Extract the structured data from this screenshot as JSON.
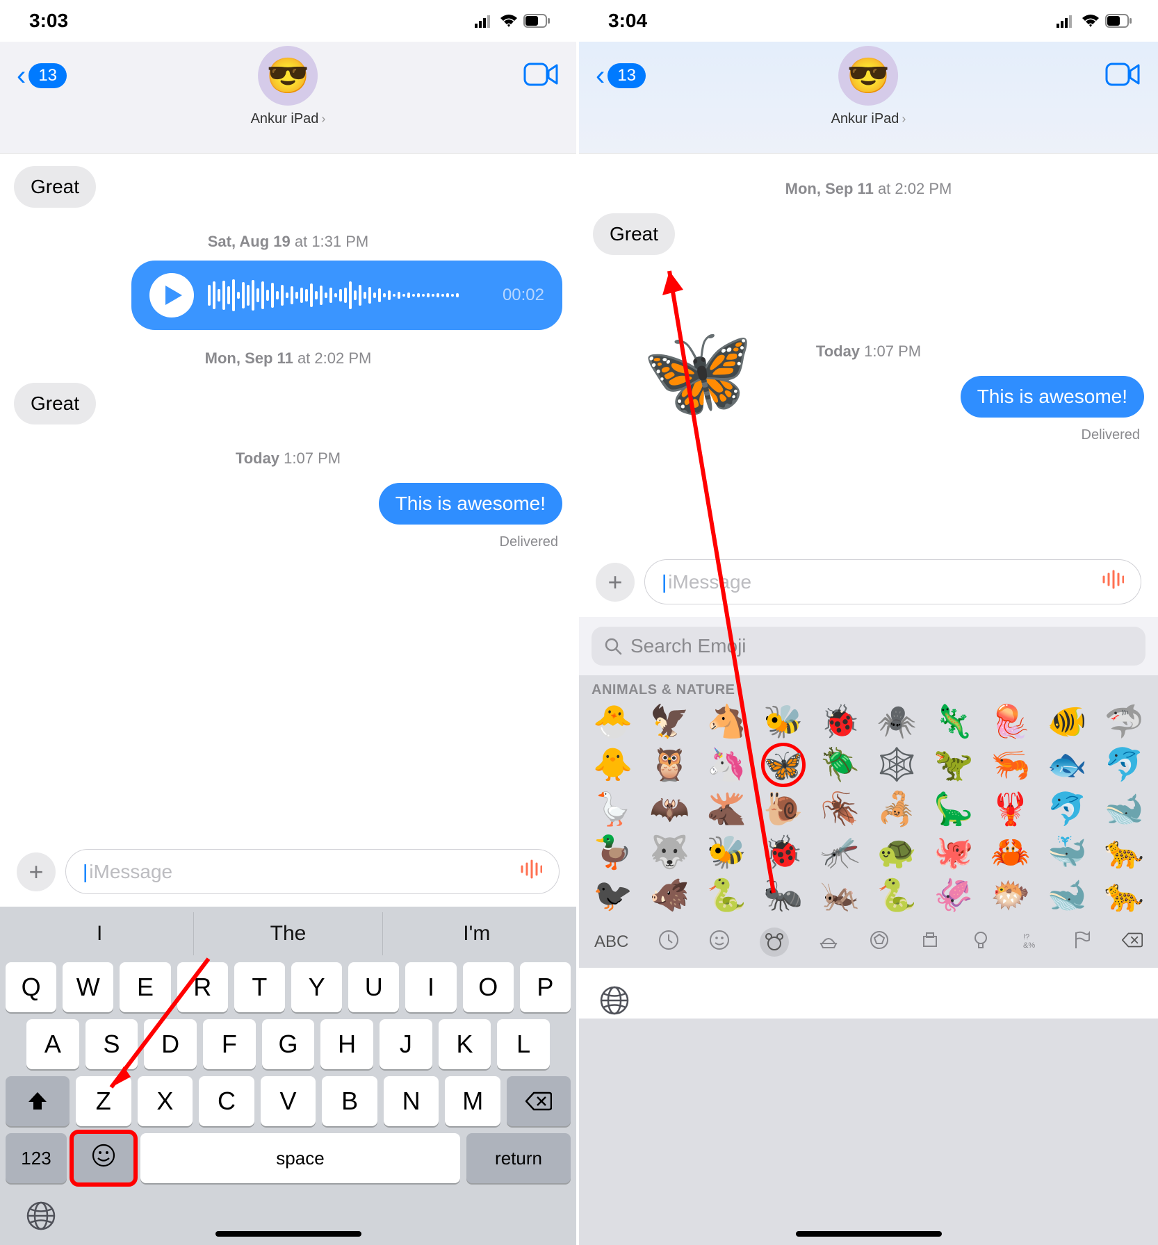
{
  "left": {
    "status": {
      "time": "3:03"
    },
    "header": {
      "back_badge": "13",
      "contact": "Ankur iPad",
      "avatar_emoji": "😎"
    },
    "msgs": {
      "gray1": "Great",
      "ts1_day": "Sat, Aug 19",
      "ts1_time": "at 1:31 PM",
      "audio_time": "00:02",
      "ts2_day": "Mon, Sep 11",
      "ts2_time": "at 2:02 PM",
      "gray2": "Great",
      "ts3_day": "Today",
      "ts3_time": "1:07 PM",
      "blue1": "This is awesome!",
      "delivered": "Delivered"
    },
    "input": {
      "placeholder": "iMessage"
    },
    "kbd": {
      "suggestions": [
        "I",
        "The",
        "I'm"
      ],
      "row1": [
        "Q",
        "W",
        "E",
        "R",
        "T",
        "Y",
        "U",
        "I",
        "O",
        "P"
      ],
      "row2": [
        "A",
        "S",
        "D",
        "F",
        "G",
        "H",
        "J",
        "K",
        "L"
      ],
      "row3": [
        "Z",
        "X",
        "C",
        "V",
        "B",
        "N",
        "M"
      ],
      "k123": "123",
      "space": "space",
      "return": "return"
    }
  },
  "right": {
    "status": {
      "time": "3:04"
    },
    "header": {
      "back_badge": "13",
      "contact": "Ankur iPad",
      "avatar_emoji": "😎"
    },
    "msgs": {
      "ts1_day": "Mon, Sep 11",
      "ts1_time": "at 2:02 PM",
      "gray1": "Great",
      "ts2_day": "Today",
      "ts2_time": "1:07 PM",
      "blue1": "This is awesome!",
      "delivered": "Delivered"
    },
    "input": {
      "placeholder": "iMessage"
    },
    "picker": {
      "search_placeholder": "Search Emoji",
      "category": "ANIMALS & NATURE",
      "rows": [
        [
          "🐣",
          "🦅",
          "🐴",
          "🐝",
          "🐞",
          "🕷️",
          "🦎",
          "🪼",
          "🐠",
          "🦈"
        ],
        [
          "🐥",
          "🦉",
          "🦄",
          "🦋",
          "🪲",
          "🕸️",
          "🦖",
          "🦐",
          "🐟",
          "🐬"
        ],
        [
          "🪿",
          "🦇",
          "🫎",
          "🐌",
          "🪳",
          "🦂",
          "🦕",
          "🦞",
          "🐬",
          "🐋"
        ],
        [
          "🦆",
          "🐺",
          "🐝",
          "🐞",
          "🦟",
          "🐢",
          "🐙",
          "🦀",
          "🐳",
          "🐆"
        ],
        [
          "🐦‍⬛",
          "🐗",
          "🐍",
          "🐜",
          "🦗",
          "🐍",
          "🦑",
          "🐡",
          "🐋",
          "🐆"
        ]
      ],
      "tabs_abc": "ABC"
    },
    "butterfly": "🦋"
  }
}
